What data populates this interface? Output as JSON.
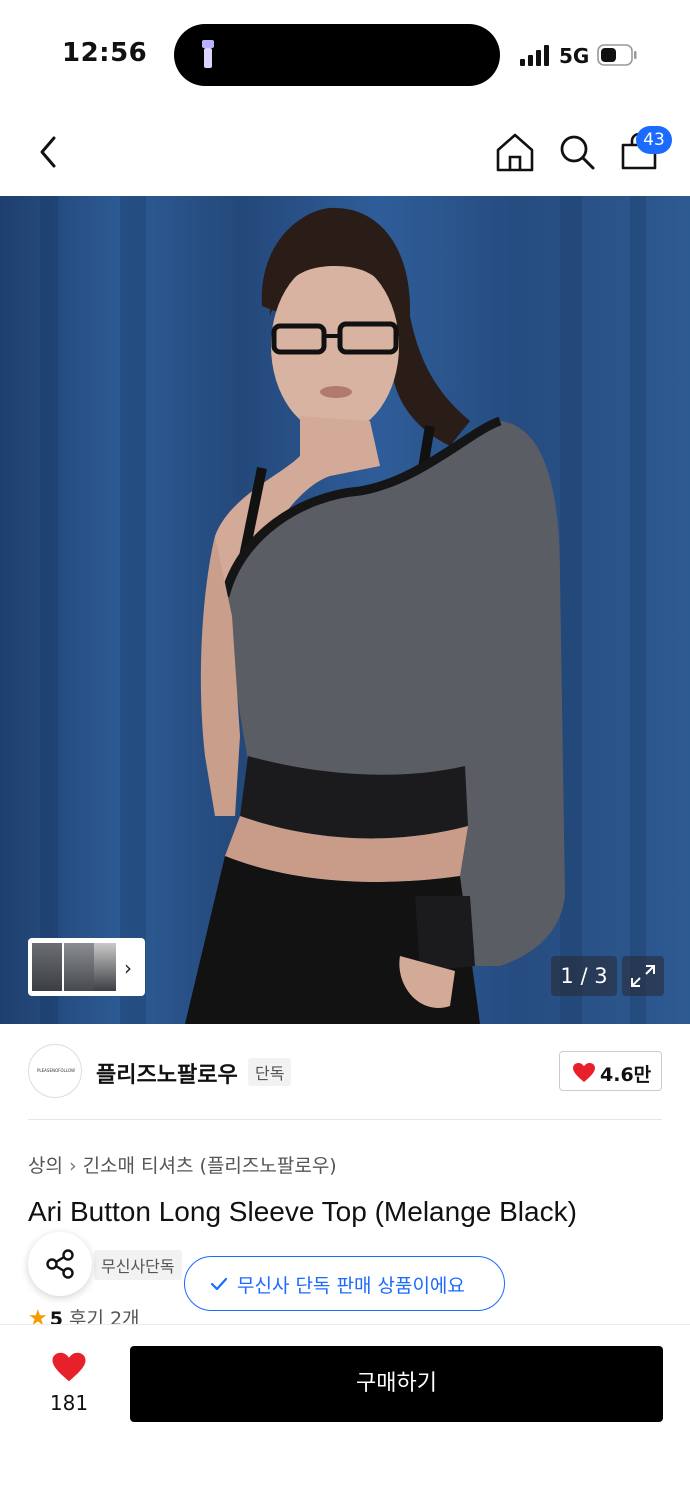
{
  "status_bar": {
    "time": "12:56",
    "network": "5G"
  },
  "nav": {
    "cart_count": "43",
    "icons": [
      "back-arrow-icon",
      "home-icon",
      "search-icon",
      "shopping-bag-icon"
    ]
  },
  "hero": {
    "counter": "1 / 3"
  },
  "brand": {
    "logo_text": "PLEASENOFOLLOW",
    "name": "플리즈노팔로우",
    "tag": "단독",
    "likes": "4.6만"
  },
  "product": {
    "breadcrumb": [
      "상의",
      "긴소매 티셔츠 (플리즈노팔로우)"
    ],
    "title": "Ari Button Long Sleeve Top (Melange Black)",
    "exclusive_tag": "무신사단독",
    "notice": "무신사 단독 판매 상품이에요",
    "rating": "5",
    "reviews": "후기 2개"
  },
  "bottom_bar": {
    "wish_count": "181",
    "buy_label": "구매하기"
  },
  "colors": {
    "accent_blue": "#1b6bff",
    "heart_red": "#e8202a",
    "star_orange": "#f59a00"
  }
}
